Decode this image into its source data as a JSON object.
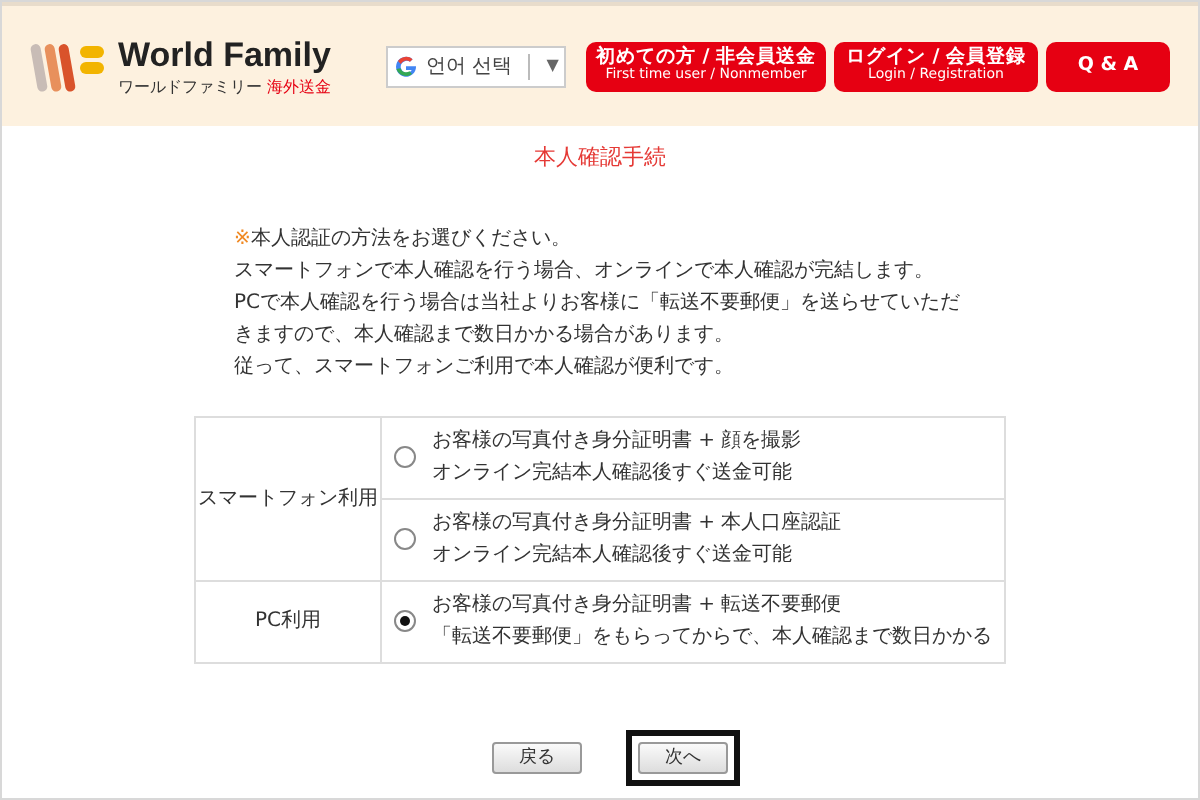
{
  "header": {
    "logo": {
      "name": "World Family",
      "subtitle": "ワールドファミリー",
      "tag": "海外送金"
    },
    "language": {
      "label": "언어 선택",
      "caret": "▼"
    },
    "nav": [
      {
        "label": "初めての方 / 非会員送金",
        "sub": "First time user / Nonmember"
      },
      {
        "label": "ログイン / 会員登録",
        "sub": "Login / Registration"
      },
      {
        "label": "Q & A"
      }
    ]
  },
  "title": "本人確認手続",
  "intro": {
    "mark": "※",
    "lines": [
      "本人認証の方法をお選びください。",
      "スマートフォンで本人確認を行う場合、オンラインで本人確認が完結します。",
      "PCで本人確認を行う場合は当社よりお客様に「転送不要郵便」を送らせていただ",
      "きますので、本人確認まで数日かかる場合があります。",
      "従って、スマートフォンご利用で本人確認が便利です。"
    ]
  },
  "methods": [
    {
      "label": "スマートフォン利用",
      "options": [
        {
          "line1": "お客様の写真付き身分証明書 + 顔を撮影",
          "line2": "オンライン完結本人確認後すぐ送金可能",
          "selected": false
        },
        {
          "line1": "お客様の写真付き身分証明書 + 本人口座認証",
          "line2": "オンライン完結本人確認後すぐ送金可能",
          "selected": false
        }
      ]
    },
    {
      "label": "PC利用",
      "options": [
        {
          "line1": "お客様の写真付き身分証明書 + 転送不要郵便",
          "line2": "「転送不要郵便」をもらってからで、本人確認まで数日かかる",
          "selected": true
        }
      ]
    }
  ],
  "buttons": [
    {
      "label": "戻る",
      "focused": false
    },
    {
      "label": "次へ",
      "focused": true
    }
  ]
}
